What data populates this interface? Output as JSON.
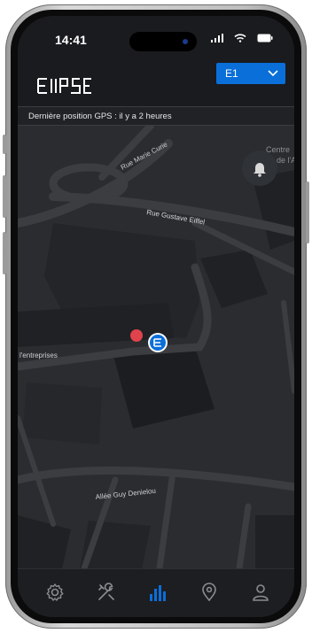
{
  "status_bar": {
    "time": "14:41"
  },
  "header": {
    "app_name": "ELLIPSE",
    "vehicle_select": {
      "value": "E1"
    }
  },
  "gps_banner": {
    "text": "Dernière position GPS : il y a 2 heures"
  },
  "map": {
    "labels": {
      "rue_marie_curie": "Rue Marie Curie",
      "rue_gustave_eiffel": "Rue Gustave Eiffel",
      "entreprises": "l'entreprises",
      "allee_guy_denielou": "Allée Guy Denielou",
      "centre_line1": "Centre",
      "centre_line2": "de l'A"
    },
    "markers": [
      {
        "type": "red-dot",
        "color": "#e0434b"
      },
      {
        "type": "vehicle-pin",
        "color": "#0a6fd9"
      }
    ]
  },
  "bottom_nav": {
    "items": [
      {
        "icon": "settings-icon",
        "active": false
      },
      {
        "icon": "tools-icon",
        "active": false
      },
      {
        "icon": "stats-icon",
        "active": true
      },
      {
        "icon": "location-icon",
        "active": false
      },
      {
        "icon": "user-icon",
        "active": false
      }
    ]
  },
  "colors": {
    "accent": "#0a6fd9",
    "background": "#1c1e21",
    "map_road": "#3b3d41",
    "map_building": "#1f2124"
  }
}
